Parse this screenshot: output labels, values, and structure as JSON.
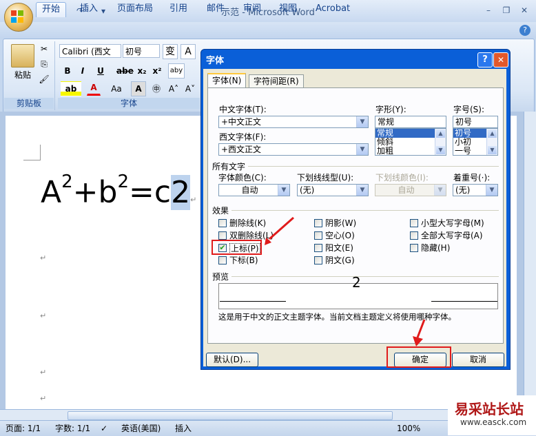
{
  "window": {
    "title": "示范 - Microsoft Word"
  },
  "tabs": [
    "开始",
    "插入",
    "页面布局",
    "引用",
    "邮件",
    "审阅",
    "视图",
    "Acrobat"
  ],
  "ribbon": {
    "clipboard": {
      "paste_label": "粘贴",
      "group_label": "剪贴板"
    },
    "font": {
      "font_name": "Calibri (西文",
      "font_size": "初号",
      "group_label": "字体"
    }
  },
  "document": {
    "equation": {
      "base_a": "A",
      "exp_a": "2",
      "plus": "+b",
      "exp_b": "2",
      "eq": "=c",
      "selected": "2"
    },
    "para_mark": "↵"
  },
  "status": {
    "page": "页面: 1/1",
    "words": "字数: 1/1",
    "language": "英语(美国)",
    "mode": "插入",
    "zoom": "100%"
  },
  "dialog": {
    "title": "字体",
    "help": "?",
    "close": "✕",
    "tabs": [
      "字体(N)",
      "字符间距(R)"
    ],
    "cn_font_label": "中文字体(T):",
    "cn_font_value": "+中文正文",
    "west_font_label": "西文字体(F):",
    "west_font_value": "+西文正文",
    "style_label": "字形(Y):",
    "style_value": "常规",
    "style_list": [
      "常规",
      "倾斜",
      "加粗"
    ],
    "size_label": "字号(S):",
    "size_value": "初号",
    "size_list": [
      "初号",
      "小初",
      "一号"
    ],
    "all_text_label": "所有文字",
    "color_label": "字体颜色(C):",
    "color_value": "自动",
    "underline_label": "下划线线型(U):",
    "underline_value": "(无)",
    "underline_color_label": "下划线颜色(I):",
    "underline_color_value": "自动",
    "emphasis_label": "着重号(·):",
    "emphasis_value": "(无)",
    "effects_label": "效果",
    "effects": [
      {
        "label": "删除线(K)",
        "checked": false
      },
      {
        "label": "双删除线(L)",
        "checked": false
      },
      {
        "label": "上标(P)",
        "checked": true
      },
      {
        "label": "下标(B)",
        "checked": false
      },
      {
        "label": "阴影(W)",
        "checked": false
      },
      {
        "label": "空心(O)",
        "checked": false
      },
      {
        "label": "阳文(E)",
        "checked": false
      },
      {
        "label": "阴文(G)",
        "checked": false
      },
      {
        "label": "小型大写字母(M)",
        "checked": false
      },
      {
        "label": "全部大写字母(A)",
        "checked": false
      },
      {
        "label": "隐藏(H)",
        "checked": false
      }
    ],
    "preview_label": "预览",
    "preview_text": "2",
    "description": "这是用于中文的正文主题字体。当前文档主题定义将使用哪种字体。",
    "default_button": "默认(D)...",
    "ok_button": "确定",
    "cancel_button": "取消"
  },
  "watermark": {
    "text": "易采站长站",
    "url": "www.easck.com"
  },
  "colors": {
    "highlight_red": "#e01b1b",
    "dialog_blue": "#0a5fd8"
  }
}
